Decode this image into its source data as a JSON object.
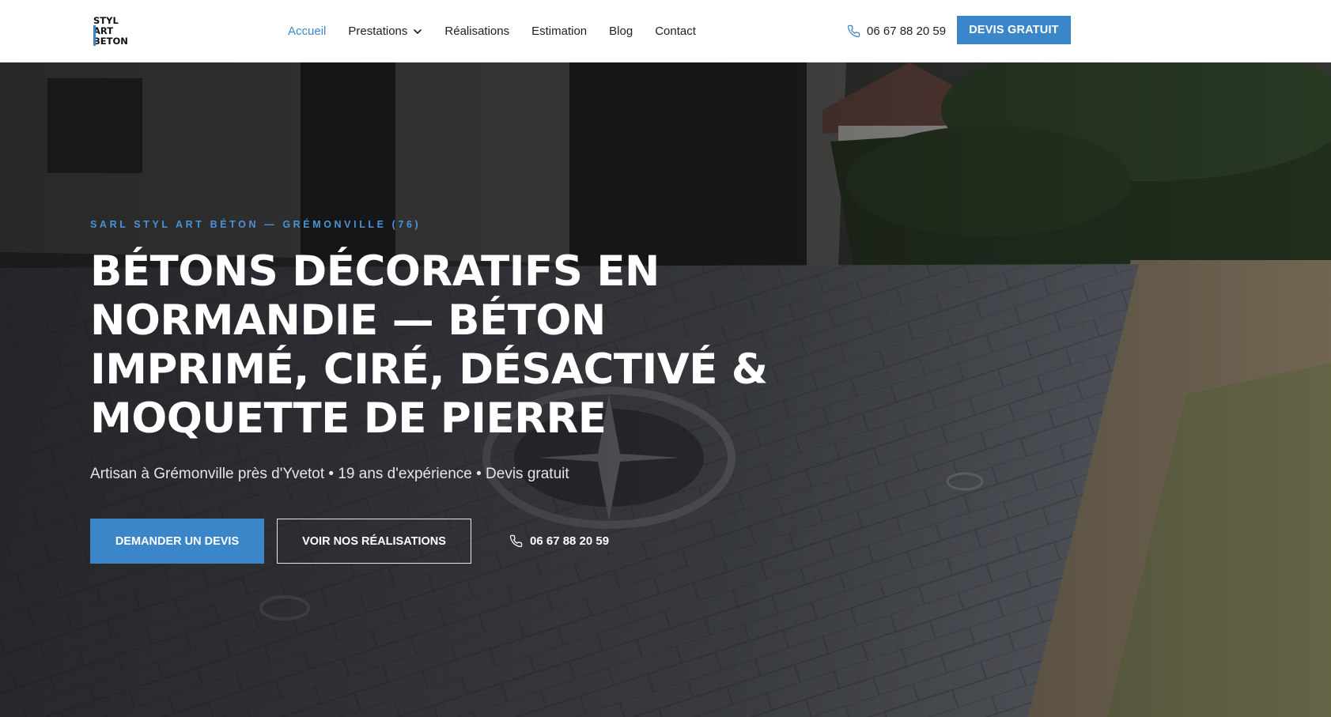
{
  "header": {
    "logo_lines": [
      "STYL",
      "ART",
      "BETON"
    ],
    "nav": [
      {
        "label": "Accueil",
        "active": true
      },
      {
        "label": "Prestations",
        "has_dropdown": true
      },
      {
        "label": "Réalisations"
      },
      {
        "label": "Estimation"
      },
      {
        "label": "Blog"
      },
      {
        "label": "Contact"
      }
    ],
    "phone": "06 67 88 20 59",
    "cta_label": "DEVIS GRATUIT"
  },
  "hero": {
    "kicker": "SARL STYL ART BÉTON — GRÉMONVILLE (76)",
    "headline": "BÉTONS DÉCORATIFS EN NORMANDIE — BÉTON IMPRIMÉ, CIRÉ, DÉSACTIVÉ & MOQUETTE DE PIERRE",
    "subtitle": "Artisan à Grémonville près d'Yvetot • 19 ans d'expérience • Devis gratuit",
    "primary_button": "DEMANDER UN DEVIS",
    "secondary_button": "VOIR NOS RÉALISATIONS",
    "phone": "06 67 88 20 59"
  },
  "icons": {
    "phone": "phone-icon",
    "dropdown": "chevron-down-icon"
  },
  "colors": {
    "accent": "#3b86c8",
    "kicker": "#4a93d6",
    "header_bg": "#ffffff",
    "hero_text": "#ffffff"
  }
}
